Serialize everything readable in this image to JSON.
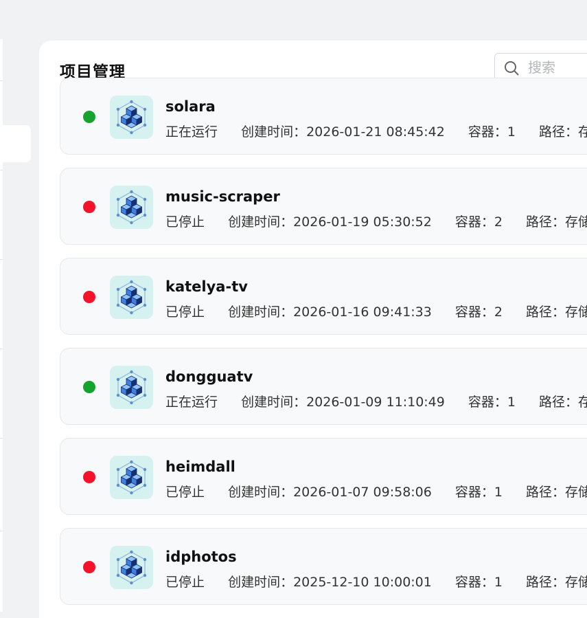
{
  "page": {
    "title": "项目管理"
  },
  "search": {
    "placeholder": "搜索",
    "value": ""
  },
  "colors": {
    "running": "#15a32e",
    "stopped": "#f5132c",
    "icon_bg": "#d6f2f0"
  },
  "projects": [
    {
      "name": "solara",
      "status": "running",
      "status_label": "正在运行",
      "created": "创建时间：2026-01-21 08:45:42",
      "containers": "容器：1",
      "path": "路径：存储空间"
    },
    {
      "name": "music-scraper",
      "status": "stopped",
      "status_label": "已停止",
      "created": "创建时间：2026-01-19 05:30:52",
      "containers": "容器：2",
      "path": "路径：存储空间"
    },
    {
      "name": "katelya-tv",
      "status": "stopped",
      "status_label": "已停止",
      "created": "创建时间：2026-01-16 09:41:33",
      "containers": "容器：2",
      "path": "路径：存储空间"
    },
    {
      "name": "dongguatv",
      "status": "running",
      "status_label": "正在运行",
      "created": "创建时间：2026-01-09 11:10:49",
      "containers": "容器：1",
      "path": "路径：存储空间"
    },
    {
      "name": "heimdall",
      "status": "stopped",
      "status_label": "已停止",
      "created": "创建时间：2026-01-07 09:58:06",
      "containers": "容器：1",
      "path": "路径：存储空间"
    },
    {
      "name": "idphotos",
      "status": "stopped",
      "status_label": "已停止",
      "created": "创建时间：2025-12-10 10:00:01",
      "containers": "容器：1",
      "path": "路径：存储空间"
    }
  ]
}
